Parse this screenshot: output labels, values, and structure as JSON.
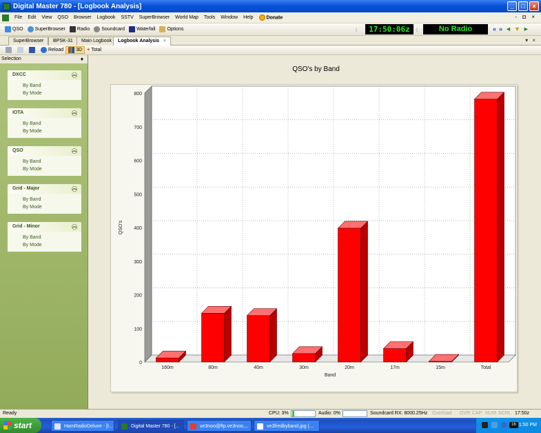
{
  "window": {
    "title": "Digital Master 780 - [Logbook Analysis]",
    "controls": [
      "_",
      "□",
      "×"
    ]
  },
  "menu": {
    "items": [
      "File",
      "Edit",
      "View",
      "QSO",
      "Browser",
      "Logbook",
      "SSTV",
      "SuperBrowser",
      "World Map",
      "Tools",
      "Window",
      "Help"
    ],
    "donate": "Donate",
    "mdi_controls": "- ◘ ×"
  },
  "toolbar": {
    "qso": "QSO",
    "superbrowser": "SuperBrowser",
    "radio": "Radio",
    "soundcard": "Soundcard",
    "waterfall": "Waterfall",
    "options": "Options",
    "clock": "17:50:06z",
    "radio_status": "No Radio",
    "nav": [
      "«",
      "»",
      "◄",
      "▼",
      "►"
    ]
  },
  "tabs": [
    {
      "label": "SuperBrowser",
      "active": false
    },
    {
      "label": "BPSK-31",
      "active": false
    },
    {
      "label": "Main Logbook",
      "active": false
    },
    {
      "label": "Logbook Analysis",
      "active": true
    }
  ],
  "tab_close": "×",
  "tabbar_controls": "▾ ×",
  "subtoolbar": {
    "reload": "Reload",
    "view3d": "3D",
    "total": "Total"
  },
  "sidebar": {
    "header": "Selection",
    "pin": "♦",
    "groups": [
      {
        "title": "DXCC",
        "items": [
          "By Band",
          "By Mode"
        ]
      },
      {
        "title": "IOTA",
        "items": [
          "By Band",
          "By Mode"
        ]
      },
      {
        "title": "QSO",
        "items": [
          "By Band",
          "By Mode"
        ]
      },
      {
        "title": "Grid - Major",
        "items": [
          "By Band",
          "By Mode"
        ]
      },
      {
        "title": "Grid - Minor",
        "items": [
          "By Band",
          "By Mode"
        ]
      }
    ]
  },
  "chart_data": {
    "type": "bar",
    "title": "QSO's by Band",
    "xlabel": "Band",
    "ylabel": "QSO's",
    "categories": [
      "160m",
      "80m",
      "40m",
      "30m",
      "20m",
      "17m",
      "15m",
      "Total"
    ],
    "values": [
      12,
      145,
      138,
      25,
      398,
      40,
      2,
      782
    ],
    "ylim": [
      0,
      800
    ],
    "yticks": [
      0,
      100,
      200,
      300,
      400,
      500,
      600,
      700,
      800
    ],
    "grid": true,
    "bar_color": "#ff0000",
    "bar_side_color": "#b80000",
    "bar_top_color": "#ff7070"
  },
  "status": {
    "ready": "Ready",
    "cpu": "CPU: 3%",
    "audio": "Audio: 0%",
    "soundcard_rx": "Soundcard RX: 8000.25Hz",
    "overload": "Overload",
    "ovr": "OVR",
    "cap": "CAP",
    "num": "NUM",
    "scrl": "SCRL",
    "time": "17:50z"
  },
  "taskbar": {
    "start": "start",
    "tasks": [
      {
        "label": "HamRadioDeluxe - [I...",
        "active": false,
        "color": "#d9e6ff"
      },
      {
        "label": "Digital Master 780 - [...",
        "active": true,
        "color": "#2a7a2a"
      },
      {
        "label": "ve3noo@ftp.ve3noo....",
        "active": false,
        "color": "#e04030"
      },
      {
        "label": "ve3fredbyband.jpg (...",
        "active": false,
        "color": "#ffffff"
      }
    ],
    "tray_badge": "16",
    "clock": "1:50 PM"
  }
}
